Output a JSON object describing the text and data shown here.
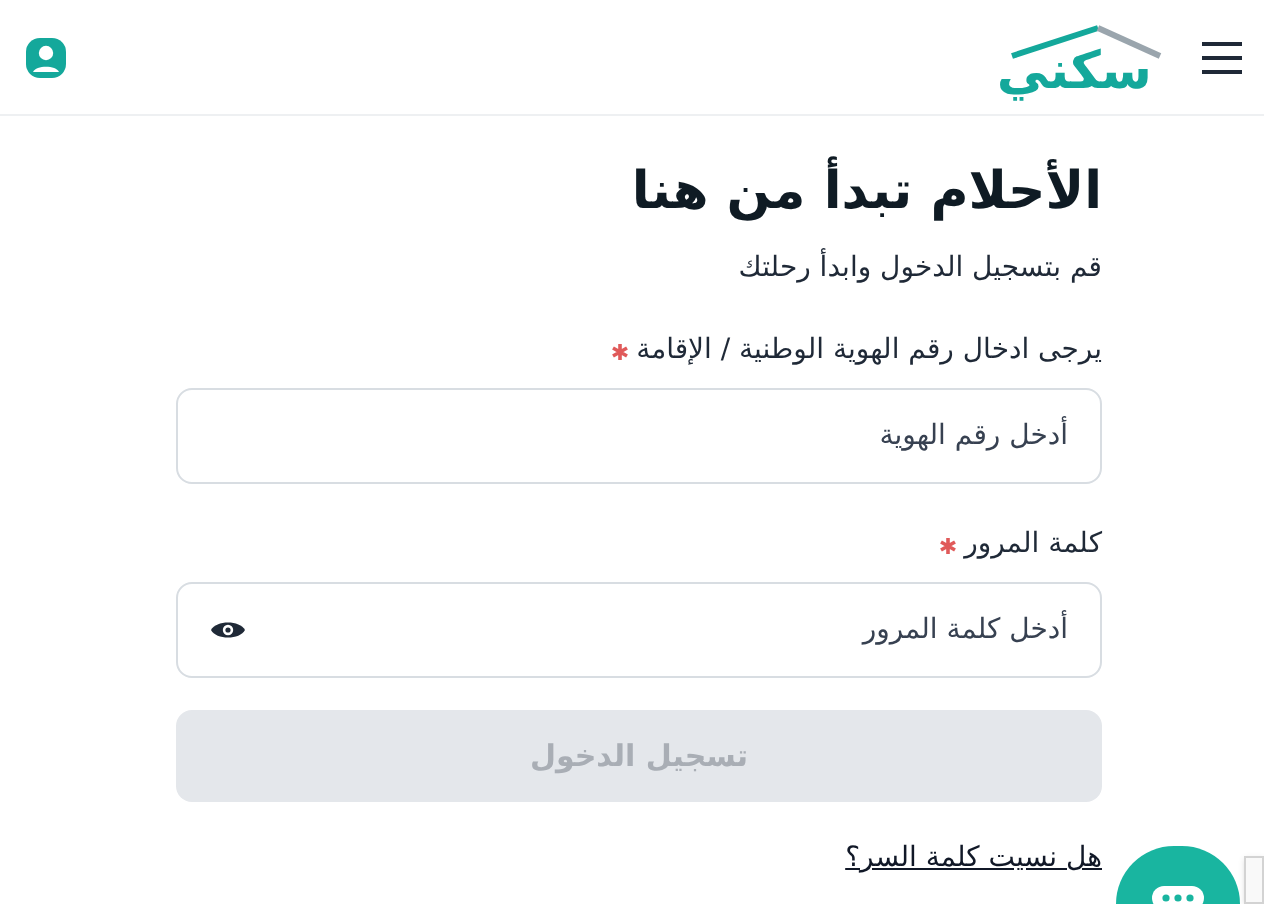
{
  "header": {
    "logo": "سكني"
  },
  "title": "الأحلام تبدأ من هنا",
  "subtitle": "قم بتسجيل الدخول وابدأ رحلتك",
  "fields": [
    {
      "label": "يرجى ادخال رقم الهوية الوطنية / الإقامة",
      "required": true,
      "placeholder": "أدخل رقم الهوية",
      "kind": "text"
    },
    {
      "label": "كلمة المرور",
      "required": true,
      "placeholder": "أدخل كلمة المرور",
      "kind": "password"
    }
  ],
  "login_button": {
    "label": "تسجيل الدخول",
    "disabled": true
  },
  "forgot_link": "هل نسيت كلمة السر؟"
}
